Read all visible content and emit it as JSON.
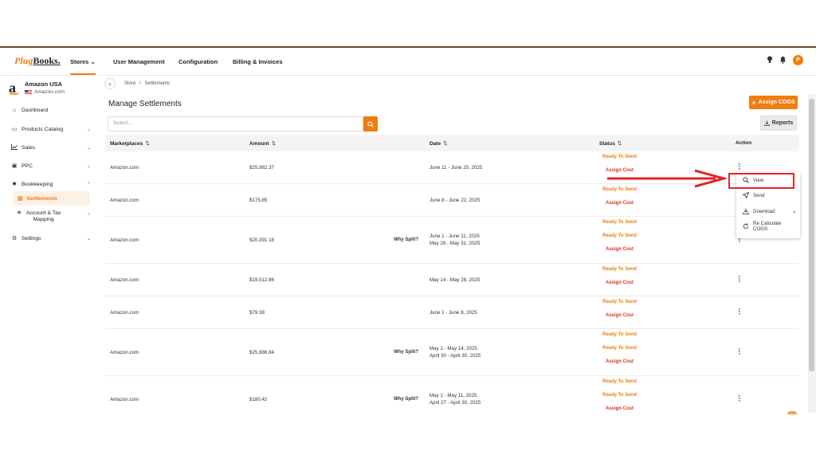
{
  "logo": {
    "part1": "Plug",
    "part2": "Books."
  },
  "nav": {
    "stores": "Stores",
    "user_management": "User Management",
    "configuration": "Configuration",
    "billing": "Billing & Invoices",
    "avatar_letter": "P"
  },
  "store": {
    "name": "Amazon USA",
    "domain": "Amazon.com"
  },
  "sidebar": {
    "dashboard": "Dashboard",
    "products_catalog": "Products Catalog",
    "sales": "Sales",
    "ppc": "PPC",
    "bookkeeping": "Bookkeeping",
    "settlements": "Settlements",
    "account_tax_1": "Account & Tax",
    "account_tax_2": "Mapping",
    "settings": "Settings"
  },
  "breadcrumb": {
    "store": "Store",
    "sep": "/",
    "current": "Settlements"
  },
  "page": {
    "title": "Manage Settlements",
    "assign_cogs": "Assign COGS",
    "search_placeholder": "Search...",
    "reports": "Reports"
  },
  "table": {
    "headers": {
      "marketplaces": "Marketplaces",
      "amount": "Amount",
      "date": "Date",
      "status": "Status",
      "action": "Action"
    },
    "rows": [
      {
        "marketplace": "Amazon.com",
        "amount": "$25,982.37",
        "why": "",
        "date1": "June 11 - June 25, 2025",
        "date2": "",
        "status": [
          "Ready To Send",
          "Assign Cost"
        ]
      },
      {
        "marketplace": "Amazon.com",
        "amount": "$175.85",
        "why": "",
        "date1": "June 8 - June 22, 2025",
        "date2": "",
        "status": [
          "Ready To Send",
          "Assign Cost"
        ]
      },
      {
        "marketplace": "Amazon.com",
        "amount": "$20,391.18",
        "why": "Why Split?",
        "date1": "June 1 - June 11, 2025",
        "date2": "May 28 - May 31, 2025",
        "status": [
          "Ready To Send",
          "Ready To Send",
          "Assign Cost"
        ]
      },
      {
        "marketplace": "Amazon.com",
        "amount": "$19,512.86",
        "why": "",
        "date1": "May 14 - May 28, 2025",
        "date2": "",
        "status": [
          "Ready To Send",
          "Assign Cost"
        ]
      },
      {
        "marketplace": "Amazon.com",
        "amount": "$79.38",
        "why": "",
        "date1": "June 1 - June 8, 2025",
        "date2": "",
        "status": [
          "Ready To Send",
          "Assign Cost"
        ]
      },
      {
        "marketplace": "Amazon.com",
        "amount": "$25,886.84",
        "why": "Why Split?",
        "date1": "May 1 - May 14, 2025",
        "date2": "April 30 - April 30, 2025",
        "status": [
          "Ready To Send",
          "Ready To Send",
          "Assign Cost"
        ]
      },
      {
        "marketplace": "Amazon.com",
        "amount": "$180.42",
        "why": "Why Split?",
        "date1": "May 1 - May 11, 2025",
        "date2": "April 27 - April 30, 2025",
        "status": [
          "Ready To Send",
          "Ready To Send",
          "Assign Cost"
        ]
      }
    ]
  },
  "menu": {
    "view": "View",
    "send": "Send",
    "download": "Download",
    "recalc1": "Re Calculate",
    "recalc2": "COGS"
  },
  "colors": {
    "accent": "#f07d10",
    "danger": "#d9361b",
    "highlight": "#e0252a"
  }
}
